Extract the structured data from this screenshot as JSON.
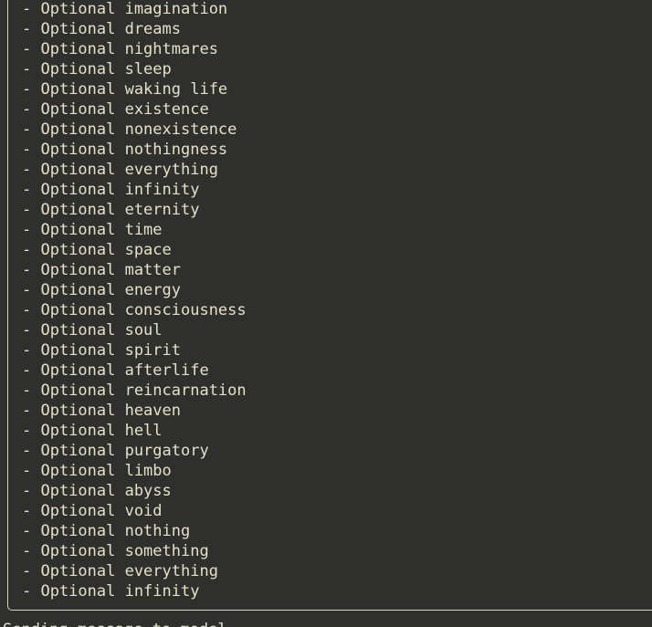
{
  "items": [
    "- Optional imagination",
    "- Optional dreams",
    "- Optional nightmares",
    "- Optional sleep",
    "- Optional waking life",
    "- Optional existence",
    "- Optional nonexistence",
    "- Optional nothingness",
    "- Optional everything",
    "- Optional infinity",
    "- Optional eternity",
    "- Optional time",
    "- Optional space",
    "- Optional matter",
    "- Optional energy",
    "- Optional consciousness",
    "- Optional soul",
    "- Optional spirit",
    "- Optional afterlife",
    "- Optional reincarnation",
    "- Optional heaven",
    "- Optional hell",
    "- Optional purgatory",
    "- Optional limbo",
    "- Optional abyss",
    "- Optional void",
    "- Optional nothing",
    "- Optional something",
    "- Optional everything",
    "- Optional infinity"
  ],
  "footer": "Sending message to model..."
}
